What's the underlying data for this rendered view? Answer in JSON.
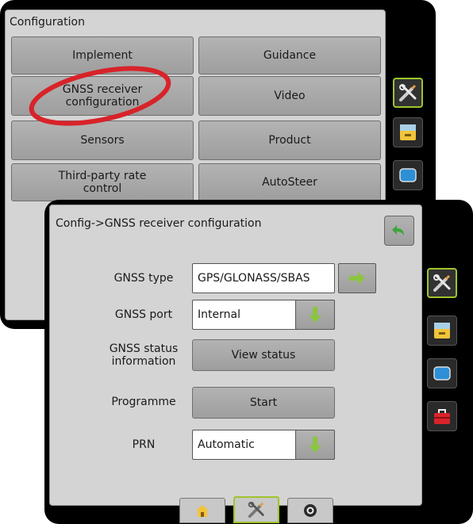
{
  "back_panel": {
    "title": "Configuration",
    "buttons": {
      "implement": "Implement",
      "guidance": "Guidance",
      "gnss_receiver": "GNSS receiver configuration",
      "video": "Video",
      "sensors": "Sensors",
      "product": "Product",
      "third_party": "Third-party rate control",
      "autosteer": "AutoSteer"
    },
    "sidebar_icons": [
      "tools-icon",
      "console-icon",
      "screen-icon"
    ]
  },
  "front_panel": {
    "title": "Config->GNSS receiver configuration",
    "rows": [
      {
        "label": "GNSS type",
        "value": "GPS/GLONASS/SBAS"
      },
      {
        "label": "GNSS port",
        "value": "Internal"
      },
      {
        "label": "GNSS status information",
        "value": "View status"
      },
      {
        "label": "Programme",
        "value": "Start"
      },
      {
        "label": "PRN",
        "value": "Automatic"
      }
    ],
    "sidebar_icons": [
      "tools-icon",
      "console-icon",
      "screen-icon",
      "toolbox-icon"
    ],
    "bottom_tabs": [
      "home-icon",
      "tools-icon",
      "camera-icon"
    ]
  },
  "annotation": {
    "type": "highlight circle",
    "color": "#d8232a"
  }
}
